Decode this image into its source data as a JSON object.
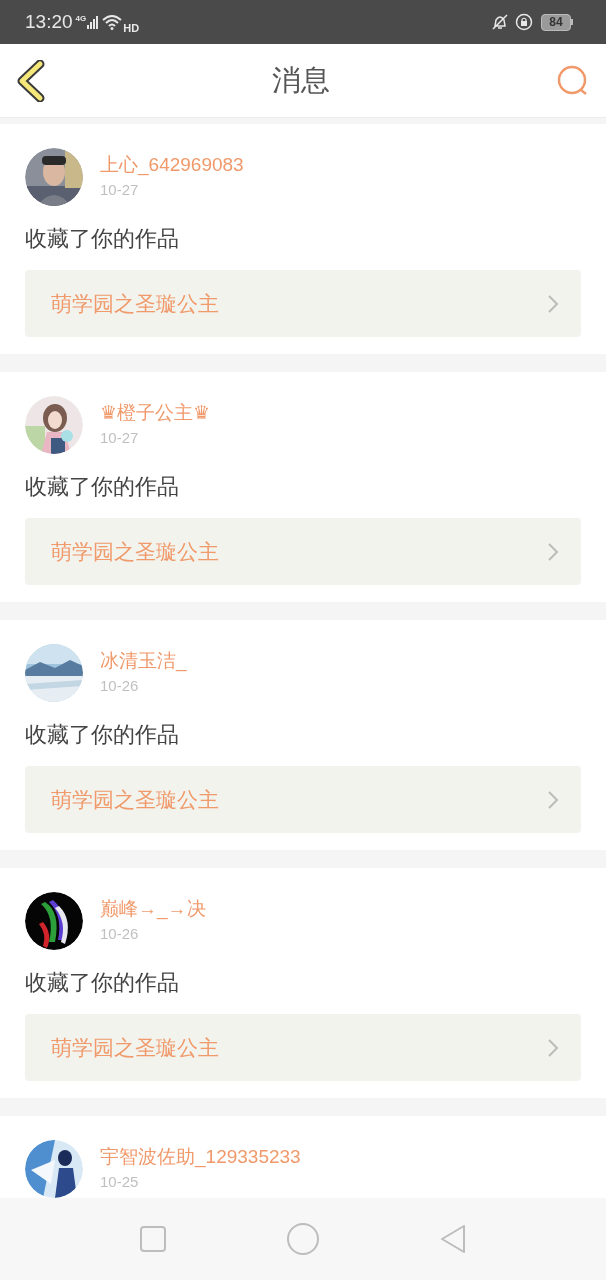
{
  "status_bar": {
    "time": "13:20",
    "network": "4G",
    "hd": "HD",
    "battery": "84"
  },
  "header": {
    "title": "消息"
  },
  "messages": [
    {
      "user": "上心_642969083",
      "date": "10-27",
      "action": "收藏了你的作品",
      "work": "萌学园之圣璇公主"
    },
    {
      "user": "♛橙子公主♛",
      "date": "10-27",
      "action": "收藏了你的作品",
      "work": "萌学园之圣璇公主"
    },
    {
      "user": "冰清玉洁_",
      "date": "10-26",
      "action": "收藏了你的作品",
      "work": "萌学园之圣璇公主"
    },
    {
      "user": "巅峰→_→决",
      "date": "10-26",
      "action": "收藏了你的作品",
      "work": "萌学园之圣璇公主"
    },
    {
      "user": "宇智波佐助_129335233",
      "date": "10-25"
    }
  ]
}
